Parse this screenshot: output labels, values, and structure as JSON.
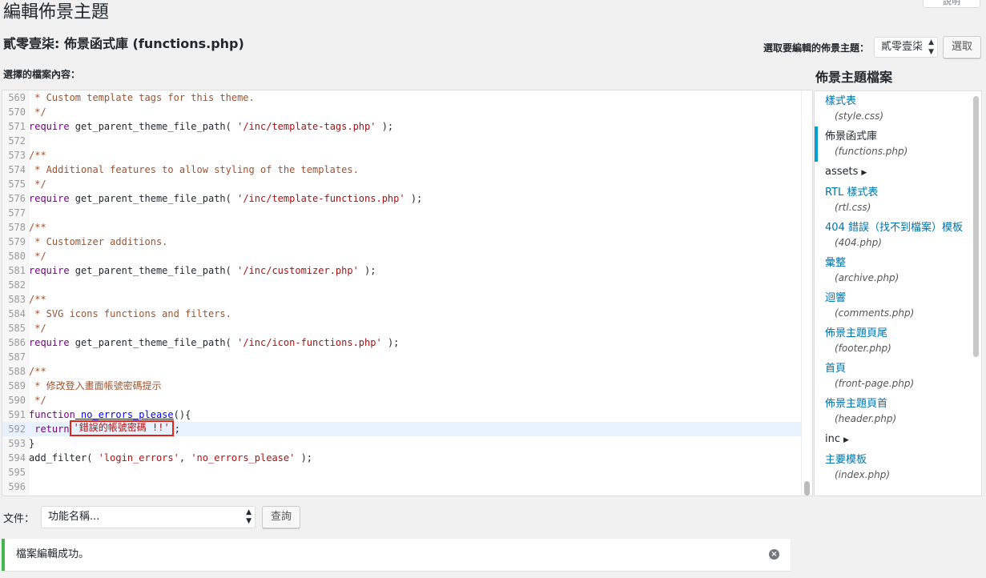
{
  "header": {
    "help_tab": "說明",
    "page_title": "編輯佈景主題",
    "file_heading": "貳零壹柒: 佈景函式庫 (functions.php)",
    "select_theme_label": "選取要編輯的佈景主題：",
    "selected_theme": "貳零壹柒",
    "select_button": "選取"
  },
  "editor": {
    "content_label": "選擇的檔案內容：",
    "active_line": 592
  },
  "code_lines": [
    {
      "n": "569",
      "t": " * Custom template tags for this theme."
    },
    {
      "n": "570",
      "t": " */"
    },
    {
      "n": "571",
      "kw": "require",
      "fn": " get_parent_theme_file_path( ",
      "str": "'/inc/template-tags.php'",
      "tail": " );"
    },
    {
      "n": "572",
      "t": ""
    },
    {
      "n": "573",
      "t": "/**"
    },
    {
      "n": "574",
      "t": " * Additional features to allow styling of the templates."
    },
    {
      "n": "575",
      "t": " */"
    },
    {
      "n": "576",
      "kw": "require",
      "fn": " get_parent_theme_file_path( ",
      "str": "'/inc/template-functions.php'",
      "tail": " );"
    },
    {
      "n": "577",
      "t": ""
    },
    {
      "n": "578",
      "t": "/**"
    },
    {
      "n": "579",
      "t": " * Customizer additions."
    },
    {
      "n": "580",
      "t": " */"
    },
    {
      "n": "581",
      "kw": "require",
      "fn": " get_parent_theme_file_path( ",
      "str": "'/inc/customizer.php'",
      "tail": " );"
    },
    {
      "n": "582",
      "t": ""
    },
    {
      "n": "583",
      "t": "/**"
    },
    {
      "n": "584",
      "t": " * SVG icons functions and filters."
    },
    {
      "n": "585",
      "t": " */"
    },
    {
      "n": "586",
      "kw": "require",
      "fn": " get_parent_theme_file_path( ",
      "str": "'/inc/icon-functions.php'",
      "tail": " );"
    },
    {
      "n": "587",
      "t": ""
    },
    {
      "n": "588",
      "t": "/**"
    },
    {
      "n": "589",
      "t": " * 修改登入畫面帳號密碼提示"
    },
    {
      "n": "590",
      "t": " */"
    },
    {
      "n": "591",
      "kw": "function",
      "def": " no_errors_please",
      "tail": "(){"
    },
    {
      "n": "592",
      "kw": " return",
      "str": "'錯誤的帳號密碼 !!'",
      "tail": ";",
      "boxed": true
    },
    {
      "n": "593",
      "plain": "}"
    },
    {
      "n": "594",
      "fn": "add_filter( ",
      "str": "'login_errors'",
      "tail": ", ",
      "str2": "'no_errors_please'",
      "tail2": " );"
    },
    {
      "n": "595",
      "t": ""
    },
    {
      "n": "596",
      "t": ""
    }
  ],
  "sidebar": {
    "title": "佈景主題檔案",
    "items": [
      {
        "type": "file",
        "name": "樣式表",
        "path": "(style.css)"
      },
      {
        "type": "file",
        "name": "佈景函式庫",
        "path": "(functions.php)",
        "current": true
      },
      {
        "type": "folder",
        "name": "assets"
      },
      {
        "type": "file",
        "name": "RTL 樣式表",
        "path": "(rtl.css)"
      },
      {
        "type": "file",
        "name": "404 錯誤（找不到檔案）模板",
        "path": "(404.php)"
      },
      {
        "type": "file",
        "name": "彙整",
        "path": "(archive.php)"
      },
      {
        "type": "file",
        "name": "迴響",
        "path": "(comments.php)"
      },
      {
        "type": "file",
        "name": "佈景主題頁尾",
        "path": "(footer.php)"
      },
      {
        "type": "file",
        "name": "首頁",
        "path": "(front-page.php)"
      },
      {
        "type": "file",
        "name": "佈景主題頁首",
        "path": "(header.php)"
      },
      {
        "type": "folder",
        "name": "inc"
      },
      {
        "type": "file",
        "name": "主要模板",
        "path": "(index.php)"
      }
    ]
  },
  "docs": {
    "label": "文件：",
    "select_value": "功能名稱...",
    "lookup_button": "查詢"
  },
  "notice": {
    "message": "檔案編輯成功。"
  },
  "colors": {
    "accent": "#00a0d2",
    "link": "#0073aa",
    "success": "#46b450",
    "highlight_border": "#e2231a"
  }
}
